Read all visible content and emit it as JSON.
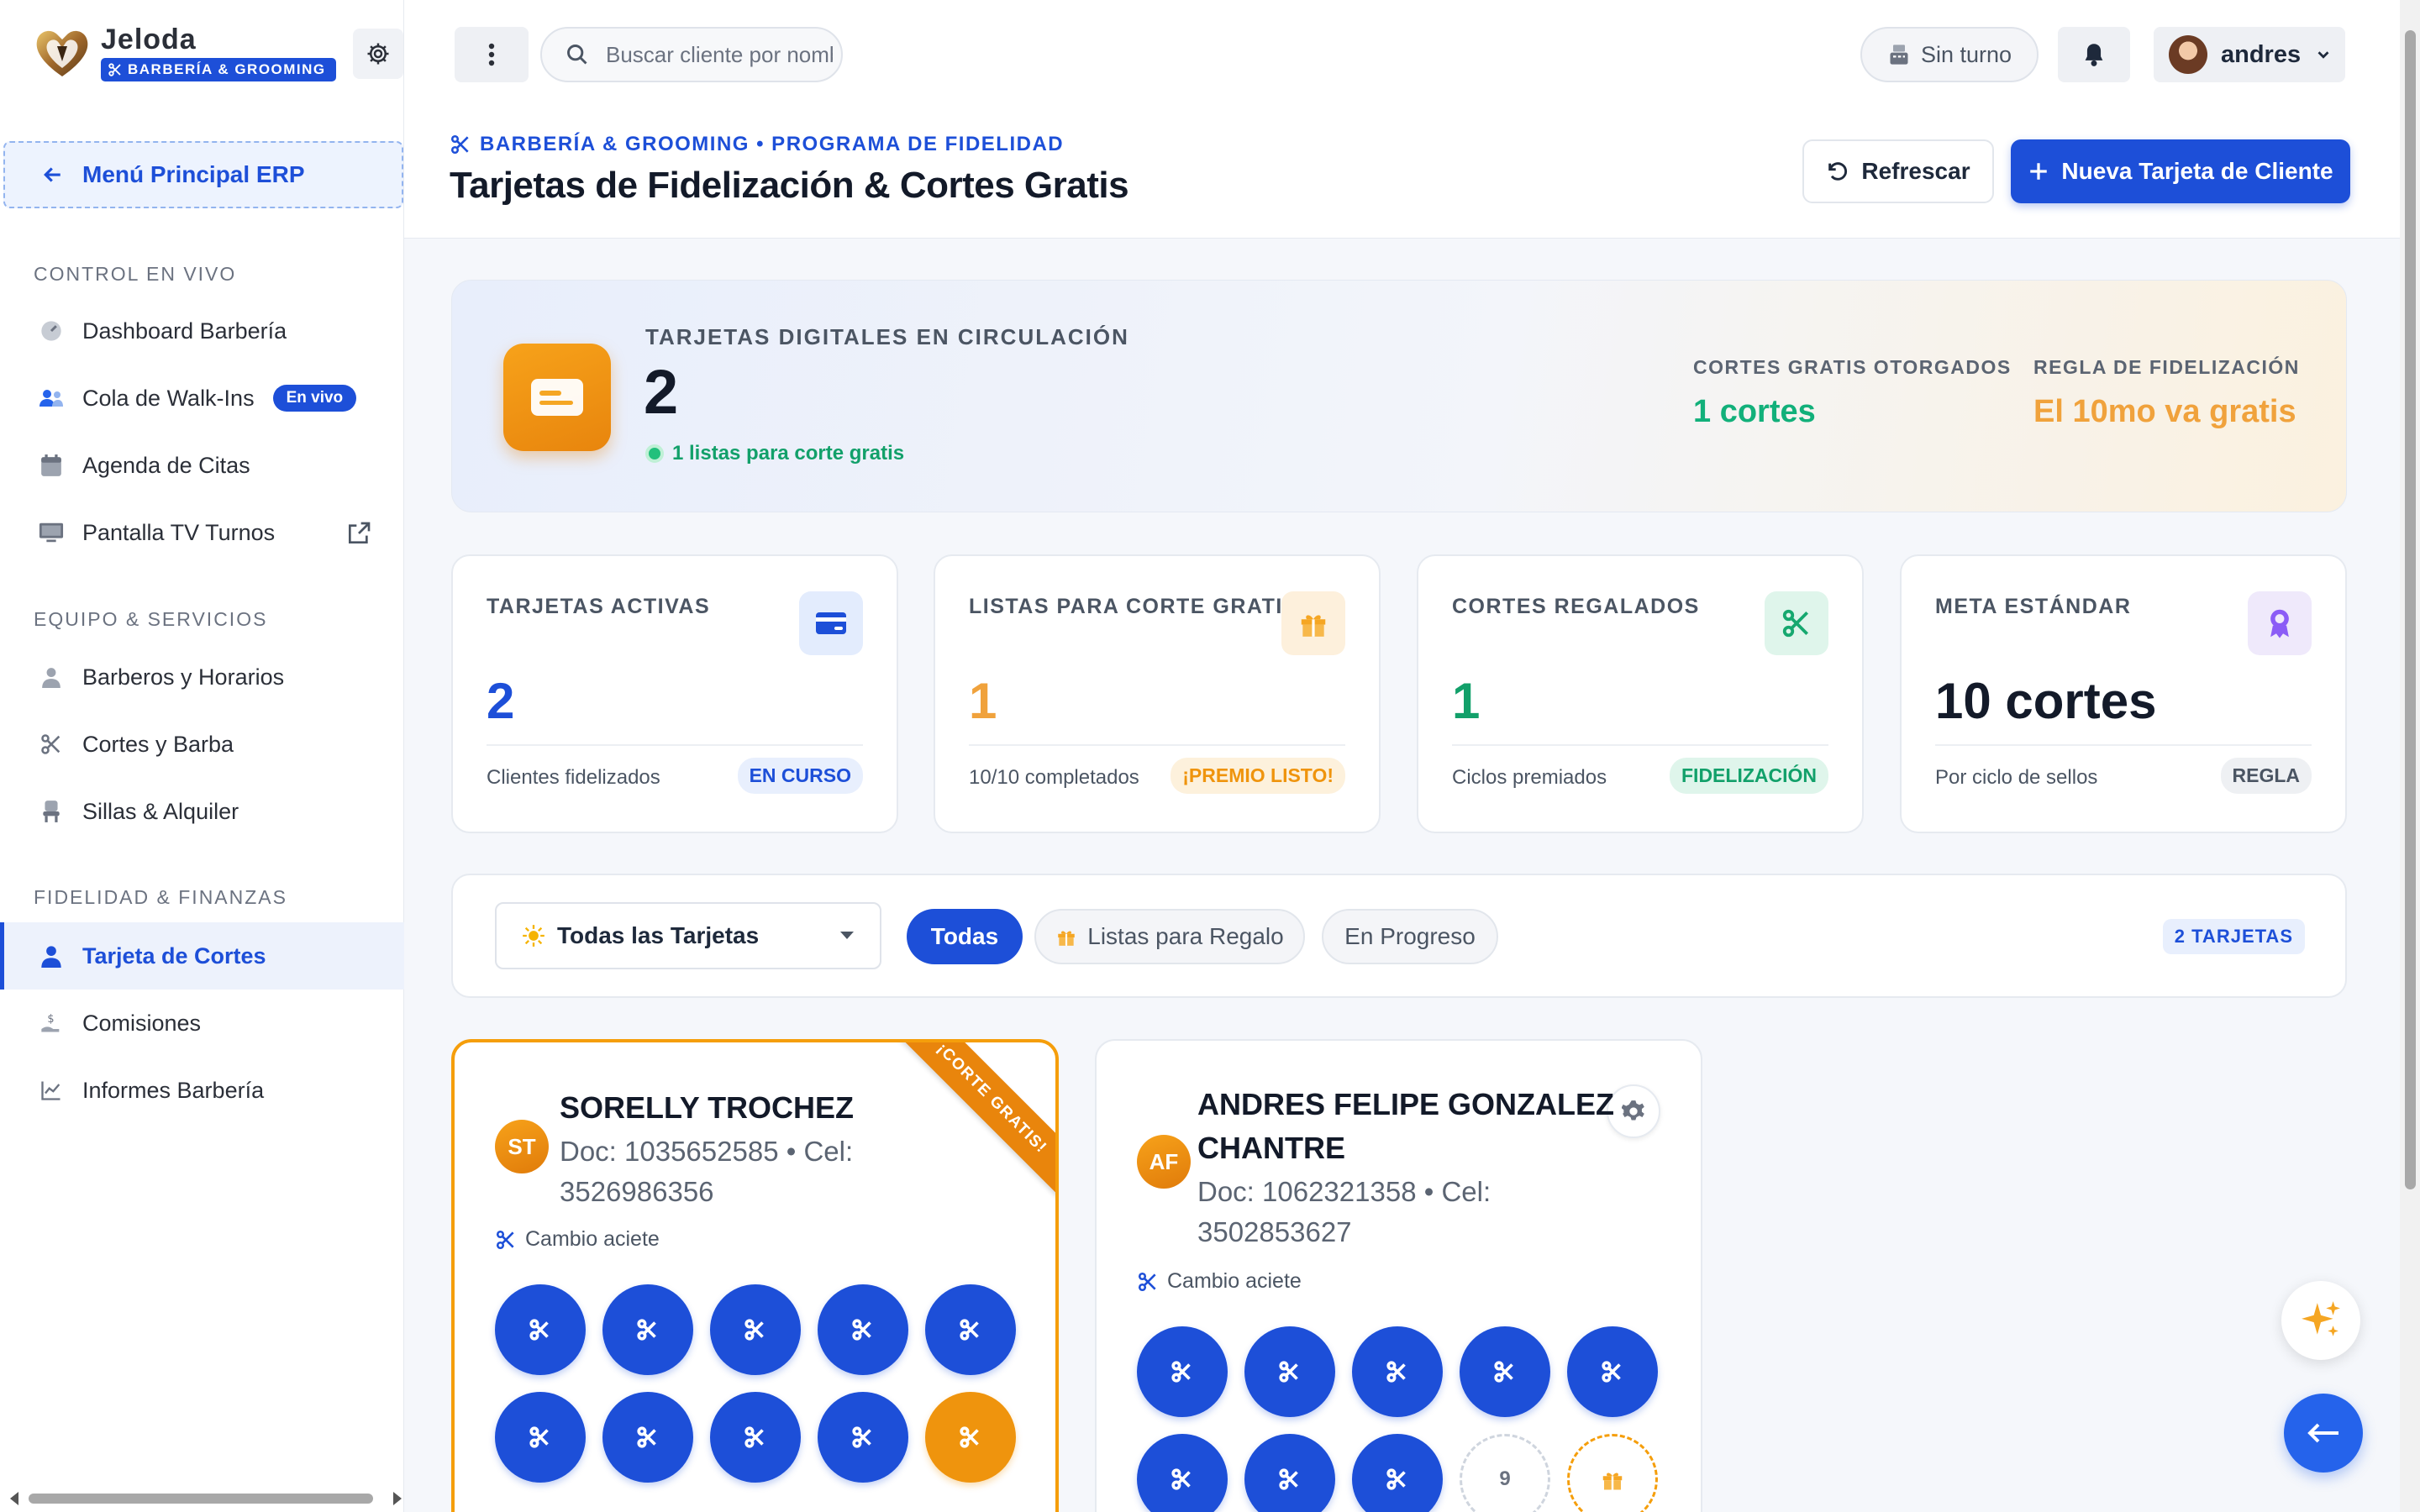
{
  "brand": {
    "name": "Jeloda",
    "badge": "BARBERÍA & GROOMING"
  },
  "sidebar": {
    "erp_button": "Menú Principal ERP",
    "sections": [
      {
        "title": "CONTROL EN VIVO",
        "items": [
          {
            "label": "Dashboard Barbería",
            "icon": "gauge-icon"
          },
          {
            "label": "Cola de Walk-Ins",
            "icon": "users-icon",
            "badge": "En vivo"
          },
          {
            "label": "Agenda de Citas",
            "icon": "calendar-icon"
          },
          {
            "label": "Pantalla TV Turnos",
            "icon": "tv-icon"
          }
        ]
      },
      {
        "title": "EQUIPO & SERVICIOS",
        "items": [
          {
            "label": "Barberos y Horarios",
            "icon": "user-icon"
          },
          {
            "label": "Cortes y Barba",
            "icon": "scissors-icon"
          },
          {
            "label": "Sillas & Alquiler",
            "icon": "chair-icon"
          }
        ]
      },
      {
        "title": "FIDELIDAD & FINANZAS",
        "items": [
          {
            "label": "Tarjeta de Cortes",
            "icon": "user-card-icon",
            "active": true
          },
          {
            "label": "Comisiones",
            "icon": "hand-coin-icon"
          },
          {
            "label": "Informes Barbería",
            "icon": "chart-line-icon"
          }
        ]
      }
    ]
  },
  "topbar": {
    "search_placeholder": "Buscar cliente por nombre",
    "shift_label": "Sin turno",
    "user_name": "andres"
  },
  "header": {
    "eyebrow": "BARBERÍA & GROOMING • PROGRAMA DE FIDELIDAD",
    "title": "Tarjetas de Fidelización & Cortes Gratis",
    "refresh_label": "Refrescar",
    "new_card_label": "Nueva Tarjeta de Cliente"
  },
  "hero": {
    "label": "TARJETAS DIGITALES EN CIRCULACIÓN",
    "value": "2",
    "sub": "1 listas para corte gratis",
    "stats": [
      {
        "label": "CORTES GRATIS OTORGADOS",
        "value": "1 cortes",
        "color": "#12b07a"
      },
      {
        "label": "REGLA DE FIDELIZACIÓN",
        "value": "El 10mo va gratis",
        "color": "#f0a23c"
      }
    ]
  },
  "stats": [
    {
      "label": "TARJETAS ACTIVAS",
      "value": "2",
      "foot": "Clientes fidelizados",
      "tag": "EN CURSO",
      "value_color": "#1d4fd8",
      "icon": "credit-card-icon"
    },
    {
      "label": "LISTAS PARA CORTE GRATIS",
      "value": "1",
      "foot": "10/10 completados",
      "tag": "¡PREMIO LISTO!",
      "value_color": "#f0a23c",
      "icon": "gift-icon"
    },
    {
      "label": "CORTES REGALADOS",
      "value": "1",
      "foot": "Ciclos premiados",
      "tag": "FIDELIZACIÓN",
      "value_color": "#12a06a",
      "icon": "scissors-icon"
    },
    {
      "label": "META ESTÁNDAR",
      "value": "10 cortes",
      "foot": "Por ciclo de sellos",
      "tag": "REGLA",
      "value_color": "#131a29",
      "icon": "award-icon"
    }
  ],
  "filters": {
    "select_value": "Todas las Tarjetas",
    "chips": [
      "Todas",
      "Listas para Regalo",
      "En Progreso"
    ],
    "count": "2 TARJETAS"
  },
  "cards": [
    {
      "initials": "ST",
      "name": "SORELLY TROCHEZ",
      "doc": "Doc: 1035652585 • Cel: 3526986356",
      "service": "Cambio aciete",
      "ribbon": "¡CORTE GRATIS!",
      "stamps_completed": 10,
      "stamps_total": 10
    },
    {
      "initials": "AF",
      "name": "ANDRES FELIPE GONZALEZ CHANTRE",
      "doc": "Doc: 1062321358 • Cel: 3502853627",
      "service": "Cambio aciete",
      "stamps_completed": 8,
      "stamps_total": 10,
      "next_stamp": "9"
    }
  ],
  "colors": {
    "primary": "#1d4fd8",
    "accent": "#f59e0b",
    "success": "#12a06a"
  }
}
